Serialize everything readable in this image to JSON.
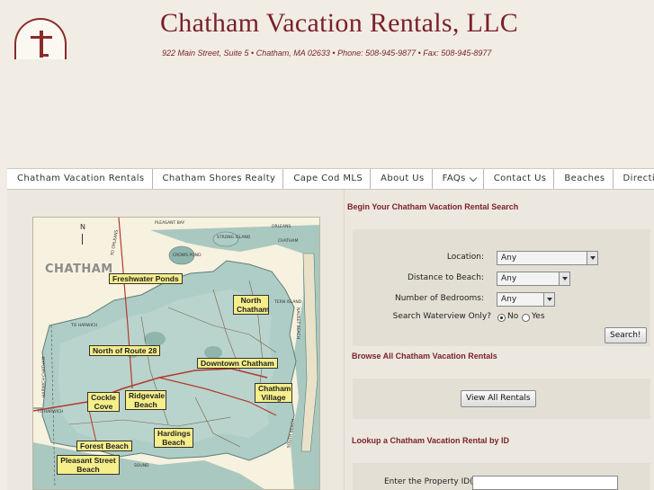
{
  "header": {
    "title": "Chatham Vacation Rentals, LLC",
    "address": "922 Main Street, Suite 5 • Chatham, MA 02633 • Phone: 508-945-9877 • Fax: 508-945-8977",
    "logo_icon": "lighthouse-logo"
  },
  "nav": {
    "items": [
      {
        "label": "Chatham Vacation Rentals"
      },
      {
        "label": "Chatham Shores Realty"
      },
      {
        "label": "Cape Cod MLS"
      },
      {
        "label": "About Us"
      },
      {
        "label": "FAQs"
      },
      {
        "label": "Contact Us"
      },
      {
        "label": "Beaches"
      },
      {
        "label": "Directions"
      }
    ]
  },
  "map": {
    "town_name": "CHATHAM",
    "compass": "N",
    "tags": {
      "pleasant_bay": "PLEASANT BAY",
      "orleans": "ORLEANS",
      "chatham": "CHATHAM",
      "strong_island": "STRONG ISLAND",
      "crows_pond": "CROWS POND",
      "to_orleans": "TO ORLEANS",
      "to_harwich_1": "TO HARWICH",
      "to_harwich_2": "TO HARWICH",
      "harwich_chatham": "HARWICH CHATHAM",
      "tern_island": "TERN ISLAND",
      "nauset_beach": "NAUSET BEACH",
      "monomoy": "SOUTH BEACH",
      "sound": "SOUND"
    },
    "labels": {
      "freshwater": "Freshwater Ponds",
      "north_chatham": "North Chatham",
      "north_route_28": "North of Route 28",
      "downtown": "Downtown Chatham",
      "chatham_village": "Chatham Village",
      "cockle_cove": "Cockle Cove",
      "ridgevale": "Ridgevale Beach",
      "hardings": "Hardings Beach",
      "forest": "Forest Beach",
      "pleasant_street": "Pleasant Street Beach"
    }
  },
  "search": {
    "heading": "Begin Your Chatham Vacation Rental Search",
    "location": {
      "label": "Location:",
      "value": "Any"
    },
    "distance": {
      "label": "Distance to Beach:",
      "value": "Any"
    },
    "bedrooms": {
      "label": "Number of Bedrooms:",
      "value": "Any"
    },
    "waterview": {
      "label": "Search Waterview Only?",
      "no": "No",
      "yes": "Yes",
      "selected": "No"
    },
    "button": "Search!"
  },
  "browse": {
    "heading": "Browse All Chatham Vacation Rentals",
    "button": "View All Rentals"
  },
  "lookup": {
    "heading": "Lookup a Chatham Vacation Rental by ID",
    "label": "Enter the Property ID(s):",
    "input_value": ""
  },
  "colors": {
    "brand": "#7a1f2b",
    "page_bg": "#f1ede4",
    "label_yellow": "#f5ee8a",
    "water": "#a9c8c0",
    "land": "#f7f1df"
  }
}
